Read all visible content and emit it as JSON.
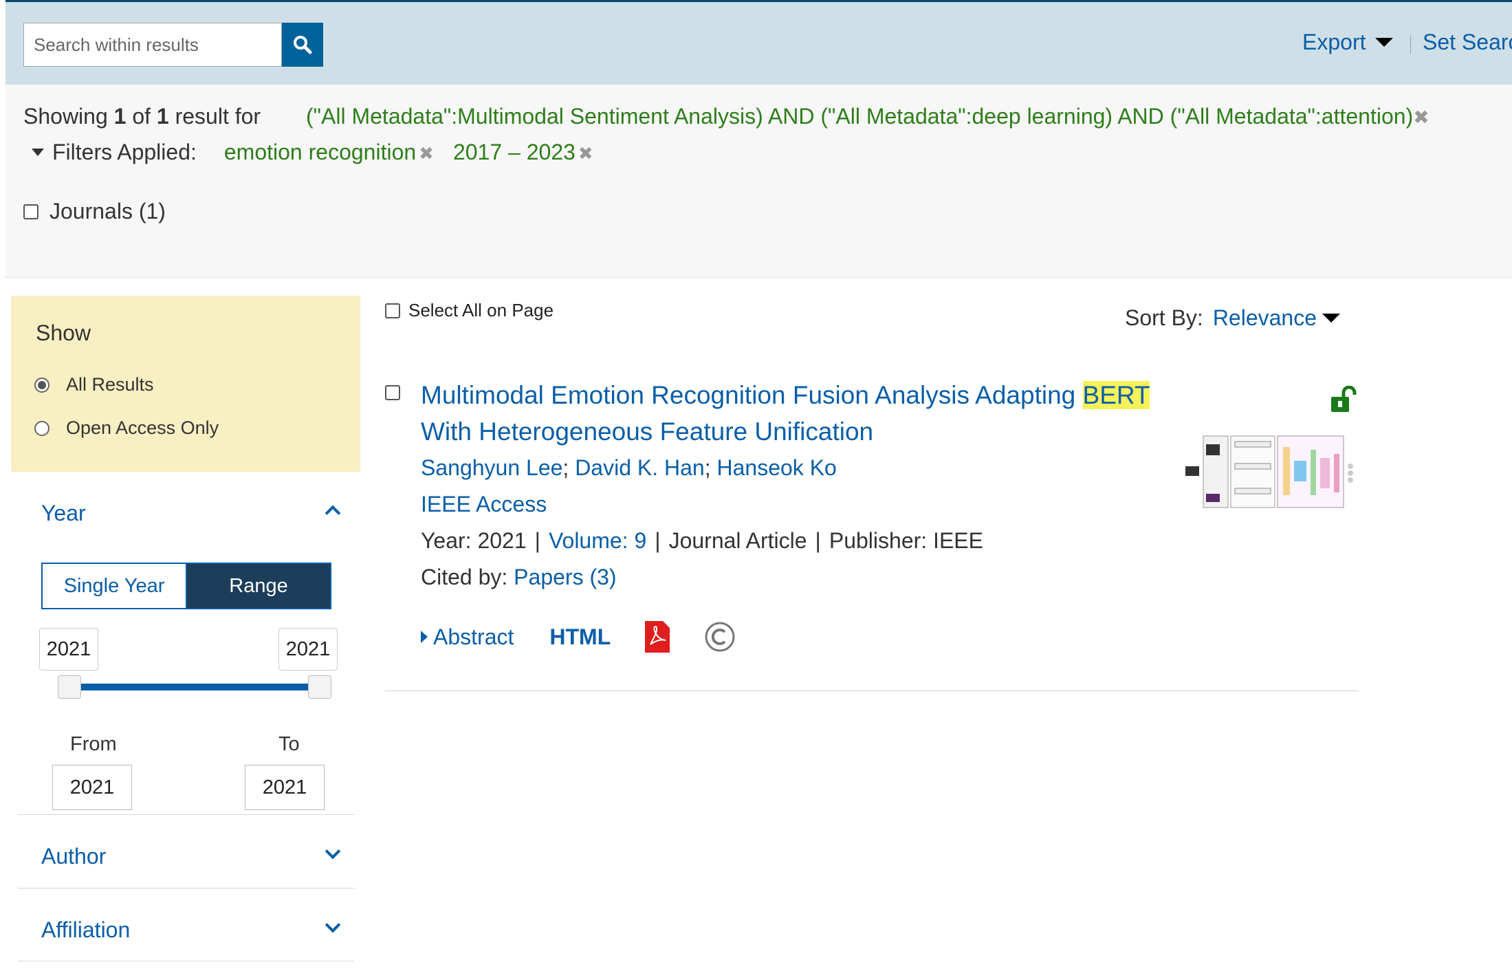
{
  "search": {
    "placeholder": "Search within results"
  },
  "header": {
    "export_label": "Export",
    "set_search_label": "Set Searc"
  },
  "summary": {
    "showing_prefix": "Showing",
    "count_shown": "1",
    "of_label": "of",
    "count_total": "1",
    "result_for_label": "result  for",
    "query": "(\"All Metadata\":Multimodal Sentiment Analysis) AND (\"All Metadata\":deep learning) AND (\"All Metadata\":attention)",
    "filters_label": "Filters Applied:",
    "filters": [
      "emotion recognition",
      "2017 – 2023"
    ],
    "journals_label": "Journals (1)"
  },
  "sidebar": {
    "show_title": "Show",
    "options": [
      "All Results",
      "Open Access Only"
    ],
    "selected_option": "All Results",
    "year": {
      "title": "Year",
      "single_label": "Single Year",
      "range_label": "Range",
      "range_min": "2021",
      "range_max": "2021",
      "from_label": "From",
      "to_label": "To",
      "from_value": "2021",
      "to_value": "2021"
    },
    "author_title": "Author",
    "affiliation_title": "Affiliation"
  },
  "results": {
    "select_all_label": "Select All on Page",
    "sort_label": "Sort By:",
    "sort_value": "Relevance",
    "items": [
      {
        "title_part1": "Multimodal Emotion Recognition Fusion Analysis Adapting",
        "title_highlight": "BERT",
        "title_part2": "With Heterogeneous Feature Unification",
        "authors": [
          "Sanghyun Lee",
          "David K. Han",
          "Hanseok Ko"
        ],
        "journal": "IEEE Access",
        "year_label": "Year:",
        "year": "2021",
        "volume_label": "Volume: 9",
        "type": "Journal Article",
        "publisher_label": "Publisher:",
        "publisher": "IEEE",
        "cited_label": "Cited by:",
        "cited_value": "Papers (3)",
        "abstract_label": "Abstract",
        "html_label": "HTML"
      }
    ]
  },
  "colors": {
    "link": "#0b5ea8",
    "query_green": "#2e7d1a",
    "topbar": "#cfdfe7",
    "show_panel": "#f8efc3",
    "range_active": "#1c3e5a"
  },
  "icons": [
    "search-icon",
    "caret-down-icon",
    "close-icon",
    "unlock-icon",
    "pdf-icon",
    "copyright-icon",
    "chevron-up-icon",
    "chevron-down-icon"
  ]
}
